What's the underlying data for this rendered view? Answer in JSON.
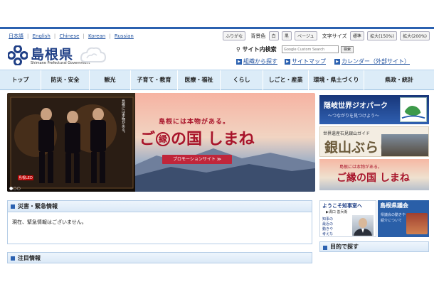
{
  "utility": {
    "languages": [
      "日本語",
      "English",
      "Chinese",
      "Korean",
      "Russian"
    ],
    "furigana": "ふりがな",
    "bg_color_label": "背景色",
    "bg_buttons": [
      "白",
      "黒",
      "ベージュ"
    ],
    "font_size_label": "文字サイズ",
    "font_buttons": [
      "標準",
      "拡大(150%)",
      "拡大(200%)"
    ]
  },
  "header": {
    "logo_ja": "島根県",
    "logo_en": "Shimane Prefectural Government",
    "search_label": "サイト内検索",
    "search_placeholder": "Google Custom Search",
    "search_button": "検索",
    "links": [
      "組織から探す",
      "サイトマップ",
      "カレンダー（外部サイト）"
    ]
  },
  "nav": [
    "トップ",
    "防災・安全",
    "観光",
    "子育て・教育",
    "医療・福祉",
    "くらし",
    "しごと・産業",
    "環境・県土づくり",
    "県政・統計"
  ],
  "hero": {
    "catch": "島根には本物がある。",
    "title_pre": "ご",
    "title_circle": "縁",
    "title_post": "の国 しまね",
    "button": "プロモーションサイト ≫",
    "poster_sign": "島根には本物がある。",
    "poster_badge": "島根LED"
  },
  "side_banners": {
    "oki_title": "隠岐世界ジオパーク",
    "oki_sub": "〜つながりを見つけよう〜",
    "ginzan_label": "世界遺産石見銀山ガイド",
    "ginzan_title": "銀山ぶらり",
    "shimane_catch": "島根には本物がある。",
    "shimane_title": "ご縁の国 しまね"
  },
  "emergency": {
    "heading": "災害・緊急情報",
    "body": "現在、緊急情報はございません。"
  },
  "notice": {
    "heading": "注目情報"
  },
  "governor": {
    "title": "ようこそ知事室へ",
    "name": "▶溝口 善兵衛",
    "desc": [
      "知事の",
      "最近の",
      "動きや",
      "考えな",
      "どの情報"
    ]
  },
  "assembly": {
    "title": "島根県議会",
    "desc": [
      "県議会の動きや",
      "紹介について"
    ]
  },
  "purpose": {
    "heading": "目的で探す"
  },
  "colors": {
    "accent": "#2b61b0",
    "nav_bg": "#dcecf8",
    "brand_red": "#a8142a"
  }
}
